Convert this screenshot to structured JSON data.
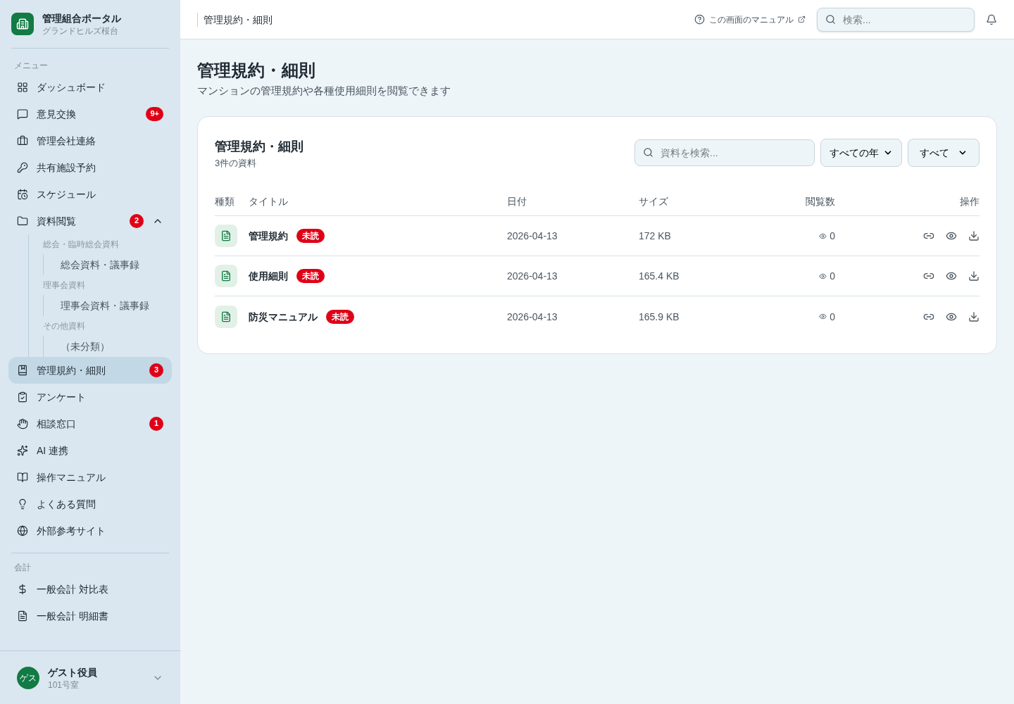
{
  "app": {
    "title": "管理組合ポータル",
    "subtitle": "グランドヒルズ桜台"
  },
  "menu_label": "メニュー",
  "menu": [
    {
      "label": "ダッシュボード",
      "selected": false
    },
    {
      "label": "意見交換",
      "badge": "9+",
      "selected": false
    },
    {
      "label": "管理会社連絡",
      "selected": false
    },
    {
      "label": "共有施設予約",
      "selected": false
    },
    {
      "label": "スケジュール",
      "selected": false
    },
    {
      "label": "資料閲覧",
      "badge": "2",
      "selected": false,
      "expanded": true,
      "children": [
        {
          "label": "総会・臨時総会資料",
          "children": [
            {
              "label": "総会資料・議事録",
              "selected": false
            }
          ]
        },
        {
          "label": "理事会資料",
          "children": [
            {
              "label": "理事会資料・議事録",
              "selected": false
            }
          ]
        },
        {
          "label": "その他資料",
          "children": [
            {
              "label": "（未分類）",
              "selected": false
            }
          ]
        }
      ]
    },
    {
      "label": "管理規約・細則",
      "badge": "3",
      "selected": true
    },
    {
      "label": "アンケート",
      "selected": false
    },
    {
      "label": "相談窓口",
      "badge": "1",
      "selected": false
    },
    {
      "label": "AI 連携",
      "selected": false
    },
    {
      "label": "操作マニュアル",
      "selected": false
    },
    {
      "label": "よくある質問",
      "selected": false
    },
    {
      "label": "外部参考サイト",
      "selected": false
    }
  ],
  "accounting_label": "会計",
  "accounting": [
    {
      "label": "一般会計 対比表",
      "selected": false
    },
    {
      "label": "一般会計 明細書",
      "selected": false
    }
  ],
  "user": {
    "avatar": "ゲス",
    "name": "ゲスト役員",
    "room": "101号室"
  },
  "header": {
    "breadcrumb": "管理規約・細則",
    "manual_link": "この画面のマニュアル",
    "search_placeholder": "検索..."
  },
  "page": {
    "title": "管理規約・細則",
    "subtitle": "マンションの管理規約や各種使用細則を閲覧できます"
  },
  "card": {
    "title": "管理規約・細則",
    "count": "3件の資料",
    "search_placeholder": "資料を検索...",
    "year_filter": "すべての年",
    "type_filter": "すべて"
  },
  "table": {
    "columns": [
      "種類",
      "タイトル",
      "日付",
      "サイズ",
      "閲覧数",
      "操作"
    ],
    "rows": [
      {
        "title": "管理規約",
        "unread": true,
        "badge": "未読",
        "date": "2026-04-13",
        "size": "172 KB",
        "views": "0"
      },
      {
        "title": "使用細則",
        "unread": true,
        "badge": "未読",
        "date": "2026-04-13",
        "size": "165.4 KB",
        "views": "0"
      },
      {
        "title": "防災マニュアル",
        "unread": true,
        "badge": "未読",
        "date": "2026-04-13",
        "size": "165.9 KB",
        "views": "0"
      }
    ]
  }
}
